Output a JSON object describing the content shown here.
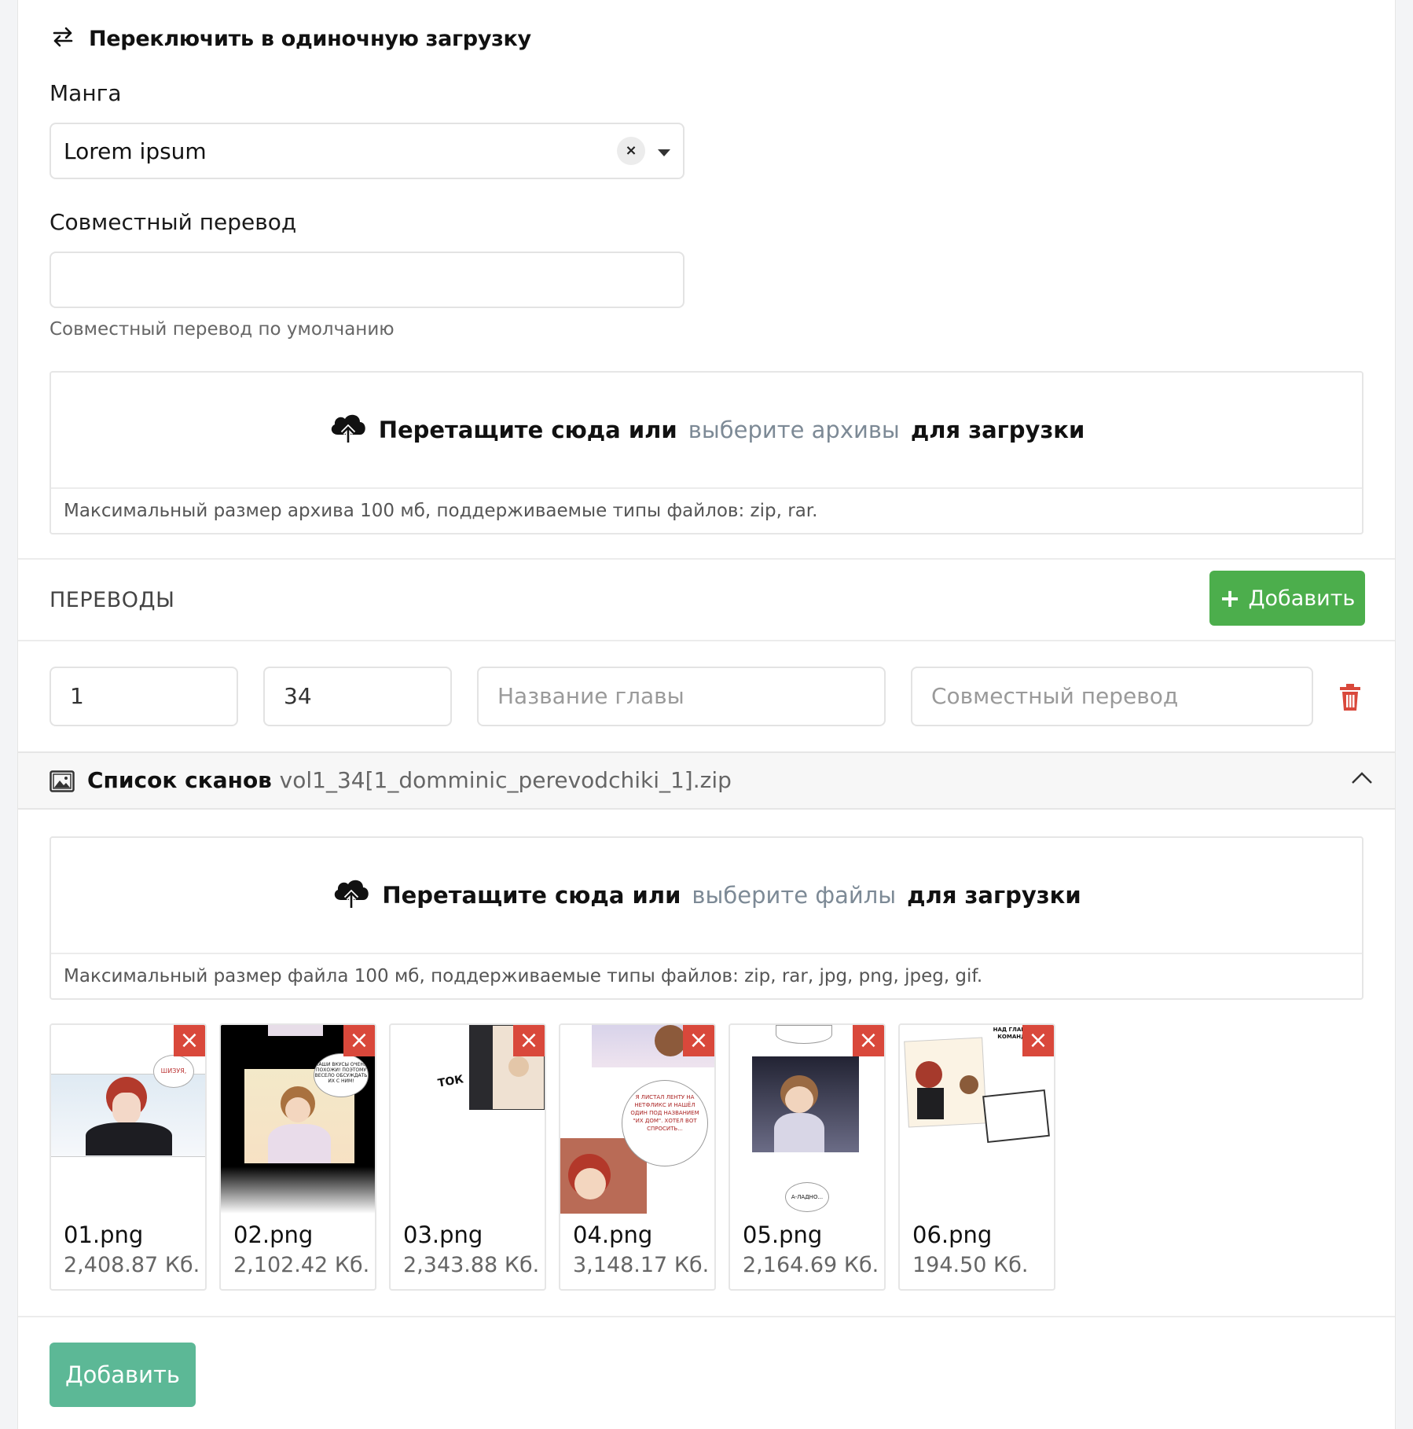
{
  "switch_mode": {
    "label": "Переключить в одиночную загрузку",
    "icon": "swap-arrows-icon"
  },
  "manga": {
    "label": "Манга",
    "value": "Lorem ipsum",
    "clear_icon": "×"
  },
  "joint": {
    "label": "Совместный перевод",
    "value": "",
    "help": "Совместный перевод по умолчанию"
  },
  "archive_dropzone": {
    "text_before": "Перетащите сюда или",
    "link": "выберите архивы",
    "text_after": "для загрузки",
    "note": "Максимальный размер архива 100 мб, поддерживаемые типы файлов: zip, rar."
  },
  "translations": {
    "title": "ПЕРЕВОДЫ",
    "add_button": "Добавить",
    "add_icon": "+",
    "row": {
      "volume": "1",
      "chapter": "34",
      "chapter_name_placeholder": "Название главы",
      "joint_placeholder": "Совместный перевод"
    }
  },
  "scans": {
    "title": "Список сканов",
    "archive_name": "vol1_34[1_domminic_perevodchiki_1].zip",
    "dropzone": {
      "text_before": "Перетащите сюда или",
      "link": "выберите файлы",
      "text_after": "для загрузки",
      "note": "Максимальный размер файла 100 мб, поддерживаемые типы файлов: zip, rar, jpg, png, jpeg, gif."
    },
    "files": [
      {
        "name": "01.png",
        "size": "2,408.87 Кб.",
        "bubble": "ШИЗУЯ,"
      },
      {
        "name": "02.png",
        "size": "2,102.42 Кб.",
        "bubble": "НАШИ ВКУСЫ ОЧЕНЬ ПОХОЖИ! ПОЭТОМУ ВЕСЕЛО ОБСУЖДАТЬ ИХ С НИМ!"
      },
      {
        "name": "03.png",
        "size": "2,343.88 Кб.",
        "bubble": "ТОК"
      },
      {
        "name": "04.png",
        "size": "3,148.17 Кб.",
        "bubble": "Я ЛИСТАЛ ЛЕНТУ НА НЕТФЛИКС И НАШЁЛ ОДИН ПОД НАЗВАНИЕМ \"ИХ ДОМ\". ХОТЕЛ ВОТ СПРОСИТЬ..."
      },
      {
        "name": "05.png",
        "size": "2,164.69 Кб.",
        "bubble": "А-ЛАДНО..."
      },
      {
        "name": "06.png",
        "size": "194.50 Кб.",
        "bubble": "НАД ГЛАВОЙ КОМАНДА"
      }
    ]
  },
  "submit_button": "Добавить",
  "colors": {
    "add_green": "#4cae4c",
    "submit_teal": "#5cb896",
    "delete_red": "#d9483b",
    "link_gray": "#7d8a96"
  }
}
